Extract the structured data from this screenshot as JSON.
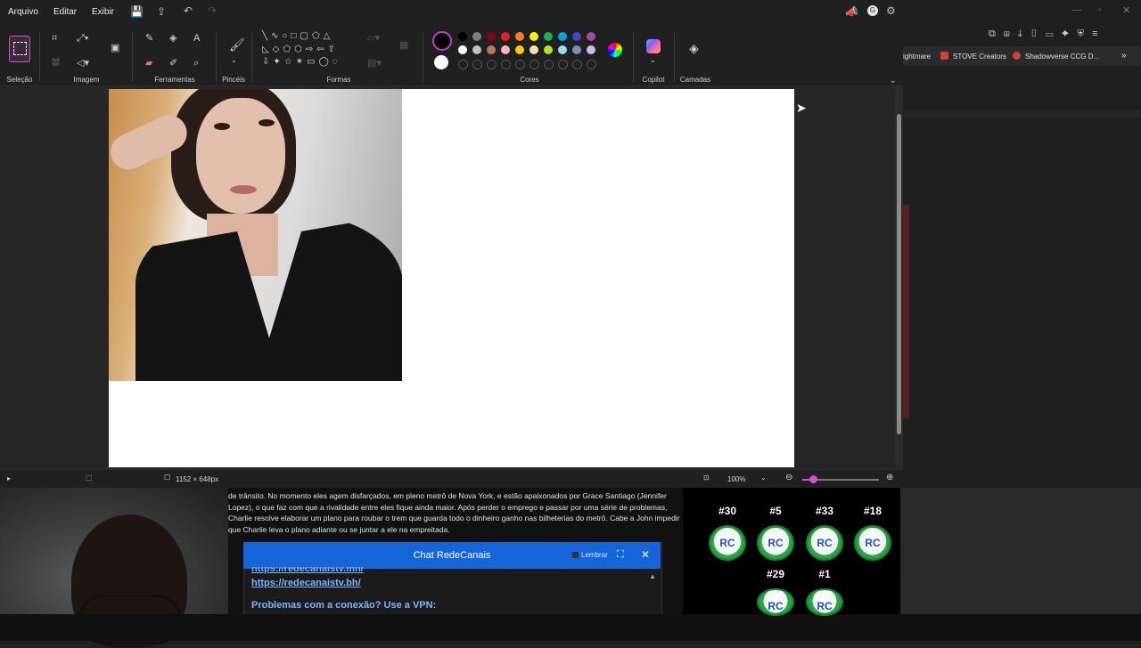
{
  "menu": {
    "file": "Arquivo",
    "edit": "Editar",
    "view": "Exibir"
  },
  "ribbon": {
    "groups": {
      "selection": "Seleção",
      "image": "Imagem",
      "tools": "Ferramentas",
      "brushes": "Pincéis",
      "shapes": "Formas",
      "colors": "Cores",
      "copilot": "Copilot",
      "layers": "Camadas"
    }
  },
  "palette": {
    "primary": "#000000",
    "secondary": "#ffffff",
    "row1": [
      "#000000",
      "#7f7f7f",
      "#880015",
      "#ed1c24",
      "#ff7f27",
      "#fff200",
      "#22b14c",
      "#00a2e8",
      "#3f48cc",
      "#a349a4"
    ],
    "row2": [
      "#ffffff",
      "#c3c3c3",
      "#b97a57",
      "#ffaec9",
      "#ffc90e",
      "#efe4b0",
      "#b5e61d",
      "#99d9ea",
      "#7092be",
      "#c8bfe7"
    ]
  },
  "statusbar": {
    "canvas_size": "1152 × 648px",
    "zoom": "100%"
  },
  "browser": {
    "bookmarks": [
      "ightmare",
      "STOVE Creators",
      "Shadowverse CCG D..."
    ]
  },
  "site": {
    "synopsis": "de trânsito. No momento eles agem disfarçados, em pleno metrô de Nova York, e estão apaixonados por Grace Santiago (Jennifer Lopez), o que faz com que a rivalidade entre eles fique ainda maior. Após perder o emprego e passar por uma série de problemas, Charlie resolve elaborar um plano para roubar o trem que guarda todo o dinheiro ganho nas bilheterias do metrô. Cabe a John impedir que Charlie leva o plano adiante ou se juntar a ele na empreitada.",
    "chat": {
      "title": "Chat RedeCanais",
      "remember": "Lembrar",
      "link1": "https://redecanaistv.mn/",
      "link2": "https://redecanaistv.bh/",
      "vpn": "Problemas com a conexão? Use a VPN:"
    },
    "servers": [
      {
        "label": "#30",
        "logo": "RC"
      },
      {
        "label": "#5",
        "logo": "RC"
      },
      {
        "label": "#33",
        "logo": "RC"
      },
      {
        "label": "#18",
        "logo": "RC"
      },
      {
        "label": "#29",
        "logo": "RC"
      },
      {
        "label": "#1",
        "logo": "RC"
      }
    ]
  }
}
